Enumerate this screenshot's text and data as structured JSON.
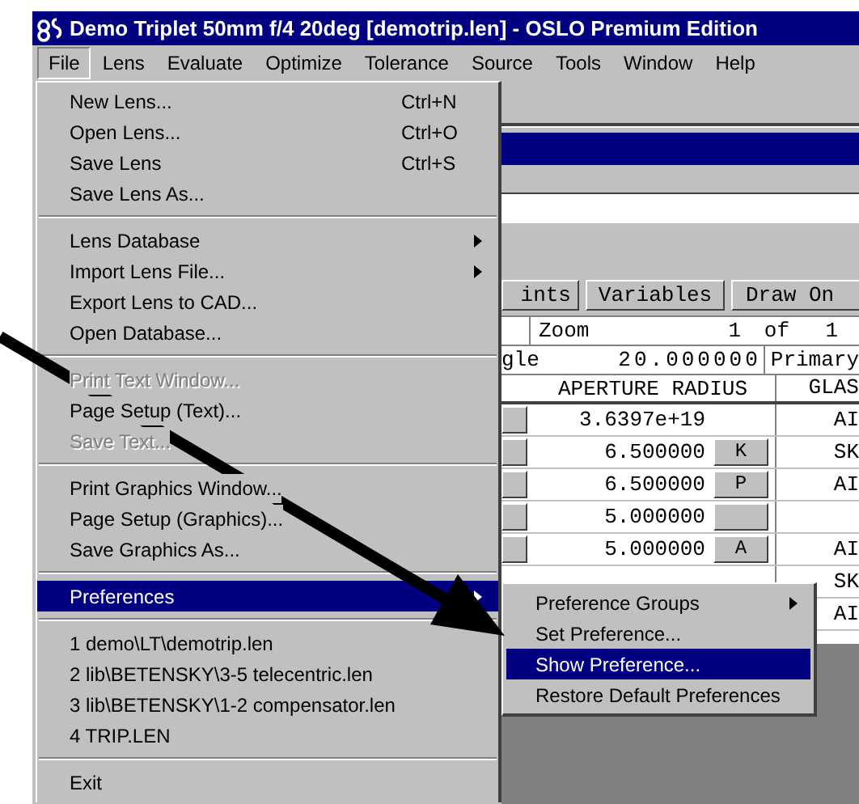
{
  "window": {
    "title": "Demo Triplet 50mm f/4 20deg [demotrip.len] - OSLO Premium Edition"
  },
  "menu_bar": [
    {
      "label": "File",
      "selected": true
    },
    {
      "label": "Lens",
      "selected": false
    },
    {
      "label": "Evaluate",
      "selected": false
    },
    {
      "label": "Optimize",
      "selected": false
    },
    {
      "label": "Tolerance",
      "selected": false
    },
    {
      "label": "Source",
      "selected": false
    },
    {
      "label": "Tools",
      "selected": false
    },
    {
      "label": "Window",
      "selected": false
    },
    {
      "label": "Help",
      "selected": false
    }
  ],
  "file_menu": [
    {
      "kind": "item",
      "label": "New Lens...",
      "shortcut": "Ctrl+N",
      "disabled": false,
      "selected": false,
      "submenu": false
    },
    {
      "kind": "item",
      "label": "Open Lens...",
      "shortcut": "Ctrl+O",
      "disabled": false,
      "selected": false,
      "submenu": false
    },
    {
      "kind": "item",
      "label": "Save Lens",
      "shortcut": "Ctrl+S",
      "disabled": false,
      "selected": false,
      "submenu": false
    },
    {
      "kind": "item",
      "label": "Save Lens As...",
      "disabled": false,
      "selected": false,
      "submenu": false
    },
    {
      "kind": "separator"
    },
    {
      "kind": "item",
      "label": "Lens Database",
      "disabled": false,
      "selected": false,
      "submenu": true
    },
    {
      "kind": "item",
      "label": "Import Lens File...",
      "disabled": false,
      "selected": false,
      "submenu": true
    },
    {
      "kind": "item",
      "label": "Export Lens to CAD...",
      "disabled": false,
      "selected": false,
      "submenu": false
    },
    {
      "kind": "item",
      "label": "Open Database...",
      "disabled": false,
      "selected": false,
      "submenu": false
    },
    {
      "kind": "separator"
    },
    {
      "kind": "item",
      "label": "Print Text Window...",
      "disabled": true,
      "selected": false,
      "submenu": false
    },
    {
      "kind": "item",
      "label": "Page Setup (Text)...",
      "disabled": false,
      "selected": false,
      "submenu": false
    },
    {
      "kind": "item",
      "label": "Save Text...",
      "disabled": true,
      "selected": false,
      "submenu": false
    },
    {
      "kind": "separator"
    },
    {
      "kind": "item",
      "label": "Print Graphics Window...",
      "disabled": false,
      "selected": false,
      "submenu": false
    },
    {
      "kind": "item",
      "label": "Page Setup (Graphics)...",
      "disabled": false,
      "selected": false,
      "submenu": false
    },
    {
      "kind": "item",
      "label": "Save Graphics As...",
      "disabled": false,
      "selected": false,
      "submenu": false
    },
    {
      "kind": "separator"
    },
    {
      "kind": "item",
      "label": "Preferences",
      "disabled": false,
      "selected": true,
      "submenu": true
    },
    {
      "kind": "separator"
    },
    {
      "kind": "item",
      "label": "1 demo\\LT\\demotrip.len",
      "disabled": false,
      "selected": false,
      "submenu": false
    },
    {
      "kind": "item",
      "label": "2 lib\\BETENSKY\\3-5 telecentric.len",
      "disabled": false,
      "selected": false,
      "submenu": false
    },
    {
      "kind": "item",
      "label": "3 lib\\BETENSKY\\1-2 compensator.len",
      "disabled": false,
      "selected": false,
      "submenu": false
    },
    {
      "kind": "item",
      "label": "4 TRIP.LEN",
      "disabled": false,
      "selected": false,
      "submenu": false
    },
    {
      "kind": "separator"
    },
    {
      "kind": "item",
      "label": "Exit",
      "disabled": false,
      "selected": false,
      "submenu": false
    }
  ],
  "preferences_submenu": [
    {
      "label": "Preference Groups",
      "selected": false,
      "submenu": true
    },
    {
      "label": "Set Preference...",
      "selected": false,
      "submenu": false
    },
    {
      "label": "Show Preference...",
      "selected": true,
      "submenu": false
    },
    {
      "label": "Restore Default Preferences",
      "selected": false,
      "submenu": false
    }
  ],
  "toolbar_buttons": [
    "ints",
    "Variables",
    "Draw On"
  ],
  "zoom_row": {
    "label": "Zoom",
    "current": "1",
    "of": "of",
    "total": "1"
  },
  "field_row": {
    "label": "gle",
    "value": "20.000000",
    "next": "Primary"
  },
  "table": {
    "columns": [
      "APERTURE RADIUS",
      "GLAS"
    ],
    "rows": [
      {
        "radius": "3.6397e+19",
        "solve_button": false,
        "glass": "AI"
      },
      {
        "radius": "6.500000",
        "solve_button": true,
        "solve": "K",
        "glass": "SK"
      },
      {
        "radius": "6.500000",
        "solve_button": true,
        "solve": "P",
        "glass": "AI"
      },
      {
        "radius": "5.000000",
        "solve_button": true
      },
      {
        "radius": "5.000000",
        "solve_button": true,
        "solve": "A",
        "glass": "AI"
      },
      {
        "glass": "SK"
      },
      {
        "glass": "AI"
      }
    ]
  }
}
